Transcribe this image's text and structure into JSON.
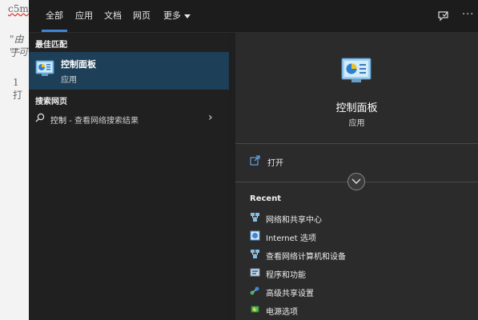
{
  "background_doc": {
    "line1": "c5m",
    "line2": "\"由于",
    "line3": "\"\"可",
    "line4": "1 打"
  },
  "tabs": [
    "全部",
    "应用",
    "文档",
    "网页",
    "更多"
  ],
  "active_tab": "全部",
  "topbar_icons": [
    "feedback-icon",
    "more-options-icon"
  ],
  "left": {
    "best_match_label": "最佳匹配",
    "best_match": {
      "title": "控制面板",
      "subtitle": "应用",
      "icon": "control-panel-icon"
    },
    "web_label": "搜索网页",
    "web_item": {
      "query": "控制",
      "suffix": " - 查看网络搜索结果"
    }
  },
  "right": {
    "app_title": "控制面板",
    "app_subtitle": "应用",
    "open_label": "打开",
    "recent_label": "Recent",
    "recent_items": [
      {
        "label": "网络和共享中心",
        "icon": "network-icon"
      },
      {
        "label": "Internet 选项",
        "icon": "internet-options-icon"
      },
      {
        "label": "查看网络计算机和设备",
        "icon": "network-devices-icon"
      },
      {
        "label": "程序和功能",
        "icon": "programs-icon"
      },
      {
        "label": "高级共享设置",
        "icon": "sharing-icon"
      },
      {
        "label": "电源选项",
        "icon": "power-icon"
      }
    ]
  },
  "colors": {
    "panel": "#1f1f1f",
    "right_pane": "#2b2b2b",
    "selected": "#1d3f58",
    "accent": "#3d86d6"
  }
}
